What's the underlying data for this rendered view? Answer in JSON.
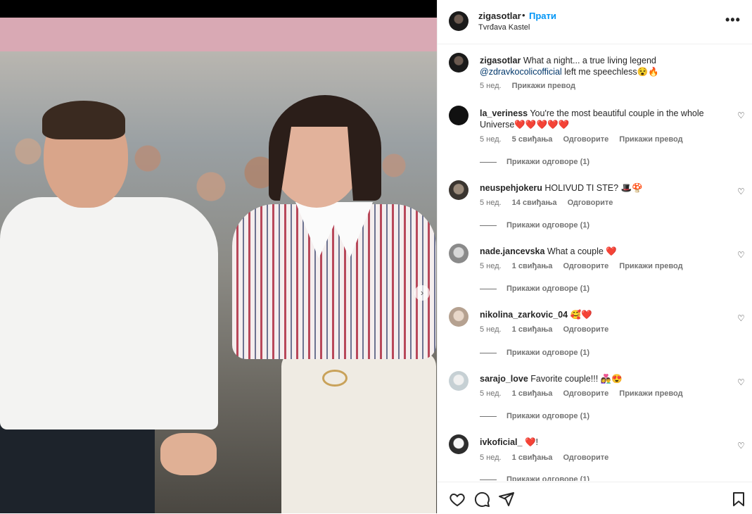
{
  "post": {
    "username": "zigasotlar",
    "dot": "•",
    "follow_label": "Прати",
    "location": "Tvrđava Kastel",
    "more_icon": "more-horizontal-icon"
  },
  "caption": {
    "username": "zigasotlar",
    "text_before": "What a night... a true living legend",
    "mention": "@zdravkocolicofficial",
    "text_after": "left me speechless😵🔥",
    "age": "5 нед.",
    "translate": "Прикажи превод"
  },
  "comments": [
    {
      "username": "la_veriness",
      "text": "You're the most beautiful couple in the whole Universe❤️❤️❤️❤️❤️",
      "age": "5 нед.",
      "likes": "5 свиђања",
      "reply": "Одговорите",
      "translate": "Прикажи превод",
      "replies": "Прикажи одговоре (1)"
    },
    {
      "username": "neuspehjokeru",
      "text": "HOLIVUD TI STE? 🎩🍄",
      "age": "5 нед.",
      "likes": "14 свиђања",
      "reply": "Одговорите",
      "translate": "",
      "replies": "Прикажи одговоре (1)"
    },
    {
      "username": "nade.jancevska",
      "text": "What a couple ❤️",
      "age": "5 нед.",
      "likes": "1 свиђања",
      "reply": "Одговорите",
      "translate": "Прикажи превод",
      "replies": "Прикажи одговоре (1)"
    },
    {
      "username": "nikolina_zarkovic_04",
      "text": "🥰❤️",
      "age": "5 нед.",
      "likes": "1 свиђања",
      "reply": "Одговорите",
      "translate": "",
      "replies": "Прикажи одговоре (1)"
    },
    {
      "username": "sarajo_love",
      "text": "Favorite couple!!! 👩‍❤️‍👨😍",
      "age": "5 нед.",
      "likes": "1 свиђања",
      "reply": "Одговорите",
      "translate": "Прикажи превод",
      "replies": "Прикажи одговоре (1)"
    },
    {
      "username": "ivkoficial_",
      "text": "❤️!",
      "age": "5 нед.",
      "likes": "1 свиђања",
      "reply": "Одговорите",
      "translate": "",
      "replies": "Прикажи одговоре (1)"
    }
  ],
  "actions": {
    "like_icon": "heart-outline-icon",
    "comment_icon": "comment-icon",
    "share_icon": "paper-plane-icon",
    "save_icon": "bookmark-icon"
  },
  "colors": {
    "accent": "#0095f6",
    "mention": "#00376b",
    "muted": "#737373",
    "heart": "#e0245e"
  }
}
